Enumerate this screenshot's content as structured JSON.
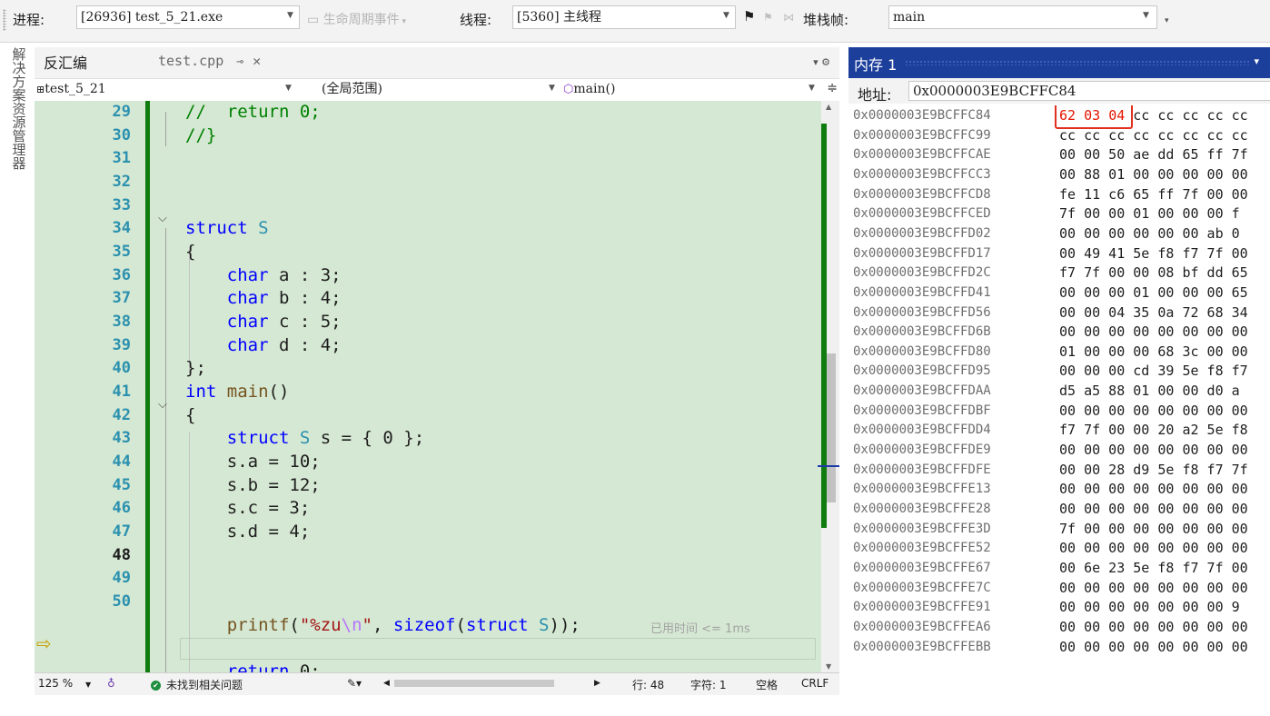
{
  "toolbar": {
    "process_label": "进程:",
    "process_value": "[26936] test_5_21.exe",
    "lifecycle_label": "生命周期事件",
    "thread_label": "线程:",
    "thread_value": "[5360] 主线程",
    "stack_label": "堆栈帧:",
    "stack_value": "main"
  },
  "side_tab": "解决方案资源管理器",
  "editor": {
    "tab_disasm": "反汇编",
    "tab_file": "test.cpp",
    "nav_project": "test_5_21",
    "nav_scope": "(全局范围)",
    "nav_func": "main()",
    "hint": "已用时间 <= 1ms",
    "line_numbers": [
      "29",
      "30",
      "31",
      "32",
      "33",
      "34",
      "35",
      "36",
      "37",
      "38",
      "39",
      "40",
      "41",
      "42",
      "43",
      "44",
      "45",
      "46",
      "47",
      "48",
      "49",
      "50"
    ],
    "current_line": "48"
  },
  "status": {
    "zoom": "125 %",
    "issues": "未找到相关问题",
    "row": "行: 48",
    "col": "字符: 1",
    "space": "空格",
    "eol": "CRLF"
  },
  "memory": {
    "title": "内存 1",
    "addr_label": "地址:",
    "addr_value": "0x0000003E9BCFFC84",
    "rows": [
      {
        "addr": "0x0000003E9BCFFC84",
        "bytes": "62 03 04 cc cc cc cc cc"
      },
      {
        "addr": "0x0000003E9BCFFC99",
        "bytes": "cc cc cc cc cc cc cc cc"
      },
      {
        "addr": "0x0000003E9BCFFCAE",
        "bytes": "00 00 50 ae dd 65 ff 7f"
      },
      {
        "addr": "0x0000003E9BCFFCC3",
        "bytes": "00 88 01 00 00 00 00 00"
      },
      {
        "addr": "0x0000003E9BCFFCD8",
        "bytes": "fe 11 c6 65 ff 7f 00 00"
      },
      {
        "addr": "0x0000003E9BCFFCED",
        "bytes": "7f 00 00 01 00 00 00 f"
      },
      {
        "addr": "0x0000003E9BCFFD02",
        "bytes": "00 00 00 00 00 00 ab 0"
      },
      {
        "addr": "0x0000003E9BCFFD17",
        "bytes": "00 49 41 5e f8 f7 7f 00"
      },
      {
        "addr": "0x0000003E9BCFFD2C",
        "bytes": "f7 7f 00 00 08 bf dd 65"
      },
      {
        "addr": "0x0000003E9BCFFD41",
        "bytes": "00 00 00 01 00 00 00 65"
      },
      {
        "addr": "0x0000003E9BCFFD56",
        "bytes": "00 00 04 35 0a 72 68 34"
      },
      {
        "addr": "0x0000003E9BCFFD6B",
        "bytes": "00 00 00 00 00 00 00 00"
      },
      {
        "addr": "0x0000003E9BCFFD80",
        "bytes": "01 00 00 00 68 3c 00 00"
      },
      {
        "addr": "0x0000003E9BCFFD95",
        "bytes": "00 00 00 cd 39 5e f8 f7"
      },
      {
        "addr": "0x0000003E9BCFFDAA",
        "bytes": "d5 a5 88 01 00 00 d0 a"
      },
      {
        "addr": "0x0000003E9BCFFDBF",
        "bytes": "00 00 00 00 00 00 00 00"
      },
      {
        "addr": "0x0000003E9BCFFDD4",
        "bytes": "f7 7f 00 00 20 a2 5e f8"
      },
      {
        "addr": "0x0000003E9BCFFDE9",
        "bytes": "00 00 00 00 00 00 00 00"
      },
      {
        "addr": "0x0000003E9BCFFDFE",
        "bytes": "00 00 28 d9 5e f8 f7 7f"
      },
      {
        "addr": "0x0000003E9BCFFE13",
        "bytes": "00 00 00 00 00 00 00 00"
      },
      {
        "addr": "0x0000003E9BCFFE28",
        "bytes": "00 00 00 00 00 00 00 00"
      },
      {
        "addr": "0x0000003E9BCFFE3D",
        "bytes": "7f 00 00 00 00 00 00 00"
      },
      {
        "addr": "0x0000003E9BCFFE52",
        "bytes": "00 00 00 00 00 00 00 00"
      },
      {
        "addr": "0x0000003E9BCFFE67",
        "bytes": "00 6e 23 5e f8 f7 7f 00"
      },
      {
        "addr": "0x0000003E9BCFFE7C",
        "bytes": "00 00 00 00 00 00 00 00"
      },
      {
        "addr": "0x0000003E9BCFFE91",
        "bytes": "00 00 00 00 00 00 00 9"
      },
      {
        "addr": "0x0000003E9BCFFEA6",
        "bytes": "00 00 00 00 00 00 00 00"
      },
      {
        "addr": "0x0000003E9BCFFEBB",
        "bytes": "00 00 00 00 00 00 00 00"
      }
    ]
  },
  "colors": {
    "accent": "#1d3f9c",
    "code_bg": "#d5e8d3",
    "changed": "#107c10",
    "keyword": "#0000ff",
    "type": "#2b91af",
    "string": "#a31515",
    "comment": "#008000",
    "memory_changed": "#e51400"
  }
}
